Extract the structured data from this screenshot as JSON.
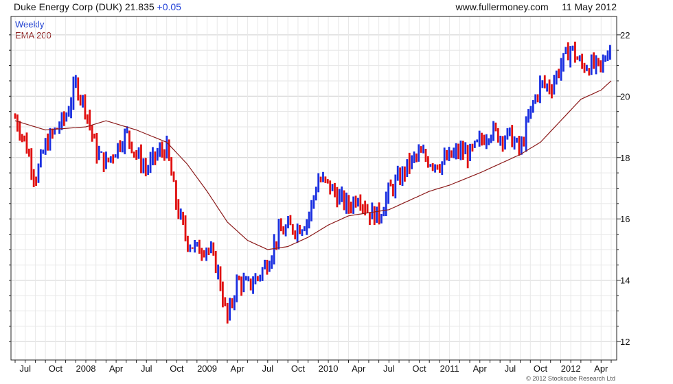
{
  "header": {
    "company": "Duke Energy Corp (DUK)",
    "price": "21.835",
    "change": "+0.05",
    "site": "www.fullermoney.com",
    "date": "11 May 2012"
  },
  "legend": {
    "series": "Weekly",
    "overlay": "EMA 200"
  },
  "copyright": "© 2012 Stockcube Research Ltd",
  "colors": {
    "up_bar": "#1a2fe0",
    "down_bar": "#e01010",
    "ema": "#8b1a1a",
    "grid": "#d8d8d8",
    "axis": "#222222"
  },
  "chart_data": {
    "type": "ohlc_bar",
    "frequency": "weekly",
    "date_range": [
      "2007-06",
      "2012-05"
    ],
    "ylim": [
      11.4,
      22.6
    ],
    "y_ticks": [
      12,
      14,
      16,
      18,
      20,
      22
    ],
    "x_tick_labels": [
      "Jul",
      "Oct",
      "2008",
      "Apr",
      "Jul",
      "Oct",
      "2009",
      "Apr",
      "Jul",
      "Oct",
      "2010",
      "Apr",
      "Jul",
      "Oct",
      "2011",
      "Apr",
      "Jul",
      "Oct",
      "2012",
      "Apr"
    ],
    "x_tick_dates": [
      "2007-07",
      "2007-10",
      "2008-01",
      "2008-04",
      "2008-07",
      "2008-10",
      "2009-01",
      "2009-04",
      "2009-07",
      "2009-10",
      "2010-01",
      "2010-04",
      "2010-07",
      "2010-10",
      "2011-01",
      "2011-04",
      "2011-07",
      "2011-10",
      "2012-01",
      "2012-04"
    ],
    "close_series": {
      "name": "Weekly",
      "points": [
        [
          "2007-06",
          19.3
        ],
        [
          "2007-07",
          18.5
        ],
        [
          "2007-08",
          17.3
        ],
        [
          "2007-09",
          18.4
        ],
        [
          "2007-10",
          18.9
        ],
        [
          "2007-11",
          19.3
        ],
        [
          "2007-12",
          20.4
        ],
        [
          "2008-01",
          19.6
        ],
        [
          "2008-02",
          18.2
        ],
        [
          "2008-03",
          17.8
        ],
        [
          "2008-04",
          18.3
        ],
        [
          "2008-05",
          18.8
        ],
        [
          "2008-06",
          18.1
        ],
        [
          "2008-07",
          17.6
        ],
        [
          "2008-08",
          18.1
        ],
        [
          "2008-09",
          18.3
        ],
        [
          "2008-10",
          16.4
        ],
        [
          "2008-11",
          15.3
        ],
        [
          "2008-12",
          15.0
        ],
        [
          "2009-01",
          15.1
        ],
        [
          "2009-02",
          14.4
        ],
        [
          "2009-03",
          12.7
        ],
        [
          "2009-04",
          14.0
        ],
        [
          "2009-05",
          13.8
        ],
        [
          "2009-06",
          14.1
        ],
        [
          "2009-07",
          14.6
        ],
        [
          "2009-08",
          15.5
        ],
        [
          "2009-09",
          15.7
        ],
        [
          "2009-10",
          15.7
        ],
        [
          "2009-11",
          16.0
        ],
        [
          "2009-12",
          17.3
        ],
        [
          "2010-01",
          17.1
        ],
        [
          "2010-02",
          16.7
        ],
        [
          "2010-03",
          16.4
        ],
        [
          "2010-04",
          16.8
        ],
        [
          "2010-05",
          16.2
        ],
        [
          "2010-06",
          16.1
        ],
        [
          "2010-07",
          16.9
        ],
        [
          "2010-08",
          17.3
        ],
        [
          "2010-09",
          17.8
        ],
        [
          "2010-10",
          18.1
        ],
        [
          "2010-11",
          17.9
        ],
        [
          "2010-12",
          17.8
        ],
        [
          "2011-01",
          18.0
        ],
        [
          "2011-02",
          18.2
        ],
        [
          "2011-03",
          18.1
        ],
        [
          "2011-04",
          18.5
        ],
        [
          "2011-05",
          18.9
        ],
        [
          "2011-06",
          18.7
        ],
        [
          "2011-07",
          18.7
        ],
        [
          "2011-08",
          18.2
        ],
        [
          "2011-09",
          19.5
        ],
        [
          "2011-10",
          20.4
        ],
        [
          "2011-11",
          20.3
        ],
        [
          "2011-12",
          21.0
        ],
        [
          "2012-01",
          21.6
        ],
        [
          "2012-02",
          21.0
        ],
        [
          "2012-03",
          21.0
        ],
        [
          "2012-04",
          20.9
        ],
        [
          "2012-05",
          21.8
        ]
      ]
    },
    "ema_series": {
      "name": "EMA 200",
      "points": [
        [
          "2007-06",
          19.2
        ],
        [
          "2007-09",
          18.9
        ],
        [
          "2008-01",
          19.0
        ],
        [
          "2008-03",
          19.2
        ],
        [
          "2008-06",
          18.9
        ],
        [
          "2008-09",
          18.5
        ],
        [
          "2008-11",
          17.8
        ],
        [
          "2009-01",
          16.9
        ],
        [
          "2009-03",
          15.9
        ],
        [
          "2009-05",
          15.3
        ],
        [
          "2009-07",
          15.0
        ],
        [
          "2009-09",
          15.1
        ],
        [
          "2009-11",
          15.4
        ],
        [
          "2010-01",
          15.8
        ],
        [
          "2010-03",
          16.1
        ],
        [
          "2010-05",
          16.2
        ],
        [
          "2010-07",
          16.3
        ],
        [
          "2010-09",
          16.6
        ],
        [
          "2010-11",
          16.9
        ],
        [
          "2011-01",
          17.1
        ],
        [
          "2011-04",
          17.5
        ],
        [
          "2011-06",
          17.8
        ],
        [
          "2011-08",
          18.1
        ],
        [
          "2011-10",
          18.5
        ],
        [
          "2011-12",
          19.2
        ],
        [
          "2012-02",
          19.9
        ],
        [
          "2012-04",
          20.2
        ],
        [
          "2012-05",
          20.5
        ]
      ]
    }
  }
}
